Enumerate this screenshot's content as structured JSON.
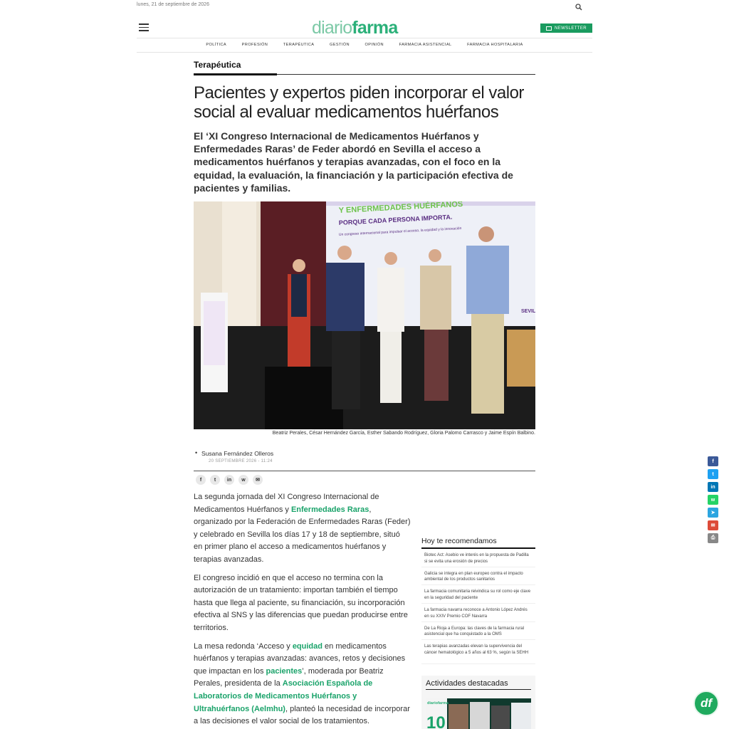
{
  "topbar": {
    "date": "lunes, 21 de septiembre de 2026",
    "search_icon": "search-icon"
  },
  "header": {
    "logo_part1": "diario",
    "logo_part2": "farma",
    "newsletter_label": "NEWSLETTER",
    "brand_color": "#2bb079"
  },
  "nav": {
    "items": [
      "POLÍTICA",
      "PROFESIÓN",
      "TERAPÉUTICA",
      "GESTIÓN",
      "OPINIÓN",
      "FARMACIA ASISTENCIAL",
      "FARMACIA HOSPITALARIA"
    ]
  },
  "article": {
    "section": "Terapéutica",
    "headline": "Pacientes y expertos piden incorporar el valor social al evaluar medicamentos huérfanos",
    "subhead": "El ‘XI Congreso Internacional de Medicamentos Huérfanos y Enfermedades Raras’ de Feder abordó en Sevilla el acceso a medicamentos huérfanos y terapias avanzadas, con el foco en la equidad, la evaluación, la financiación y la participación efectiva de pacientes y familias.",
    "photo_banner_line1": "Y ENFERMEDADES HUÉRFANOS",
    "photo_banner_line2": "PORQUE CADA PERSONA IMPORTA.",
    "photo_banner_line3": "Un congreso internacional para impulsar el acceso, la equidad y la innovación",
    "photo_city": "SEVILLA",
    "caption": "Beatriz Perales, César Hernández García, Esther Sabando Rodríguez, Gloria Palomo Carrasco y Jaime Espín Balbino.",
    "author": "Susana Fernández Olleros",
    "date": "20 SEPTIEMBRE 2026 - 11:24",
    "share_icons": [
      "facebook-icon",
      "twitter-icon",
      "linkedin-icon",
      "whatsapp-icon",
      "email-icon"
    ],
    "p1_a": "La segunda jornada del XI Congreso Internacional de Medicamentos Huérfanos y ",
    "p1_link": "Enfermedades Raras",
    "p1_b": ", organizado por la Federación de Enfermedades Raras (Feder) y celebrado en Sevilla los días 17 y 18 de septiembre, situó en primer plano el acceso a medicamentos huérfanos y terapias avanzadas.",
    "p2": "El congreso incidió en que el acceso no termina con la autorización de un tratamiento: importan también el tiempo hasta que llega al paciente, su financiación, su incorporación efectiva al SNS y las diferencias que puedan producirse entre territorios.",
    "p3_a": "La mesa redonda ‘Acceso y ",
    "p3_link1": "equidad",
    "p3_b": " en medicamentos huérfanos y terapias avanzadas: avances, retos y decisiones que impactan en los ",
    "p3_link2": "pacientes",
    "p3_c": "’, moderada por Beatriz Perales, presidenta de la ",
    "p3_link3": "Asociación Española de Laboratorios de Medicamentos Huérfanos y Ultrahuérfanos (Aelmhu)",
    "p3_d": ", planteó la necesidad de incorporar a las decisiones el valor social de los tratamientos."
  },
  "recommend": {
    "title": "Hoy te recomendamos",
    "items": [
      "Biotec Act: Asebio ve interés en la propuesta de Padilla si se evita una erosión de precios",
      "Galicia se integra en plan europeo contra el impacto ambiental de los productos sanitarios",
      "La farmacia comunitaria reivindica su rol como eje clave en la seguridad del paciente",
      "La farmacia navarra reconoce a Antonio López Andrés en su XXIV Premio COF Navarra",
      "De La Rioja a Europa: las claves de la farmacia rural asistencial que ha conquistado a la OMS",
      "Las terapias avanzadas elevan la supervivencia del cáncer hematológico a 5 años al 63 %, según la SEHH"
    ]
  },
  "activities": {
    "title": "Actividades destacadas",
    "logo": "diariofarma",
    "number": "10"
  },
  "social_rail": [
    {
      "icon": "facebook-icon",
      "glyph": "f",
      "color": "#3b5998"
    },
    {
      "icon": "twitter-icon",
      "glyph": "t",
      "color": "#1da1f2"
    },
    {
      "icon": "linkedin-icon",
      "glyph": "in",
      "color": "#0077b5"
    },
    {
      "icon": "whatsapp-icon",
      "glyph": "w",
      "color": "#25d366"
    },
    {
      "icon": "telegram-icon",
      "glyph": "➤",
      "color": "#2ca5e0"
    },
    {
      "icon": "email-icon",
      "glyph": "✉",
      "color": "#dd4b39"
    },
    {
      "icon": "print-icon",
      "glyph": "⎙",
      "color": "#888888"
    }
  ],
  "fab": {
    "label": "df"
  }
}
